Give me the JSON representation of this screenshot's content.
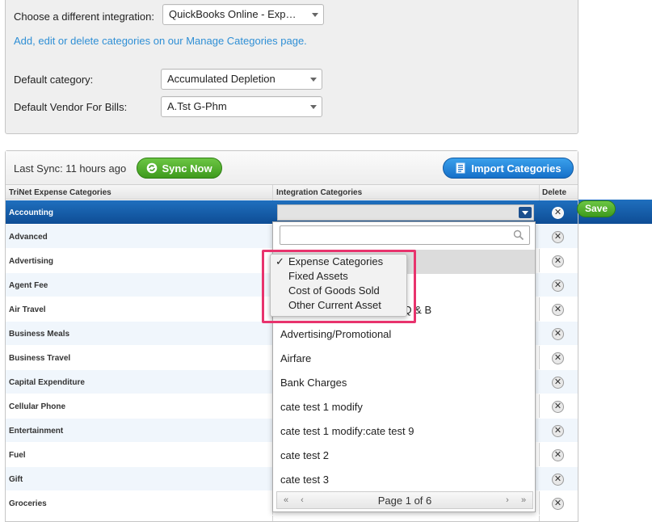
{
  "settings": {
    "integration_label": "Choose a different integration:",
    "integration_value": "QuickBooks Online - Exp…",
    "manage_link": "Add, edit or delete categories on our Manage Categories page.",
    "default_category_label": "Default category:",
    "default_category_value": "Accumulated Depletion",
    "default_vendor_label": "Default Vendor For Bills:",
    "default_vendor_value": "A.Tst G-Phm"
  },
  "toolbar": {
    "last_sync": "Last Sync: 11 hours ago",
    "sync_button": "Sync Now",
    "import_button": "Import Categories"
  },
  "columns": {
    "trinet": "TriNet Expense Categories",
    "integration": "Integration Categories",
    "delete": "Delete"
  },
  "rows": [
    "Accounting",
    "Advanced",
    "Advertising",
    "Agent Fee",
    "Air Travel",
    "Business Meals",
    "Business Travel",
    "Capital Expenditure",
    "Cellular Phone",
    "Entertainment",
    "Fuel",
    "Gift",
    "Groceries"
  ],
  "save_button": "Save",
  "dropdown": {
    "items": [
      "",
      "",
      "Advertising / Promotional- Q & B",
      "Advertising/Promotional",
      "Airfare",
      "Bank Charges",
      "cate test 1 modify",
      "cate test 1 modify:cate test 9",
      "cate test 2",
      "cate test 3"
    ],
    "pager_text": "Page 1 of 6"
  },
  "popup": {
    "checkmark": "✓",
    "items": [
      "Expense Categories",
      "Fixed Assets",
      "Cost of Goods Sold",
      "Other Current Asset"
    ]
  },
  "colors": {
    "selected_row": "#1f6fbe",
    "link": "#2f8fd5",
    "highlight_border": "#e8336d",
    "green_button": "#4fae2a",
    "blue_button": "#2488dc"
  }
}
